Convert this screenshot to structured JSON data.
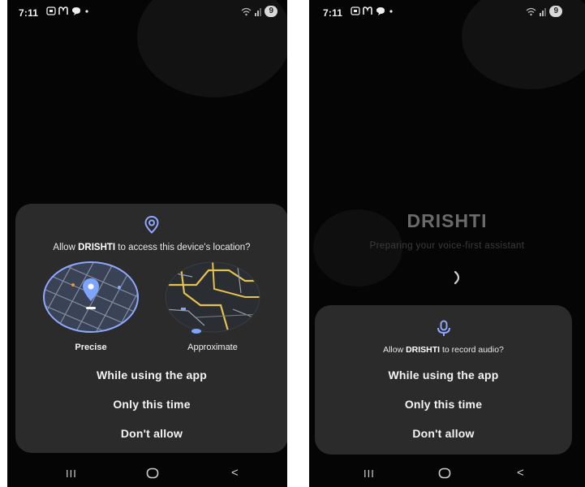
{
  "status_bar": {
    "time": "7:11",
    "battery": "9"
  },
  "left_screen": {
    "dialog": {
      "prompt_prefix": "Allow ",
      "app_name": "DRISHTI",
      "prompt_suffix": " to access this device's location?",
      "options": [
        {
          "label": "Precise"
        },
        {
          "label": "Approximate"
        }
      ],
      "buttons": {
        "while_using": "While using the app",
        "only_this_time": "Only this time",
        "dont_allow": "Don't allow"
      }
    }
  },
  "right_screen": {
    "brand": "DRISHTI",
    "subtitle": "Preparing your voice-first assistant",
    "dialog": {
      "prompt_prefix": "Allow ",
      "app_name": "DRISHTI",
      "prompt_suffix": " to record audio?",
      "buttons": {
        "while_using": "While using the app",
        "only_this_time": "Only this time",
        "dont_allow": "Don't allow"
      }
    }
  },
  "nav_bar": {
    "recents": "III",
    "back": "<"
  },
  "colors": {
    "accent": "#8fa8ff",
    "dialog_bg": "#2b2b2b",
    "screen_bg": "#050505"
  }
}
